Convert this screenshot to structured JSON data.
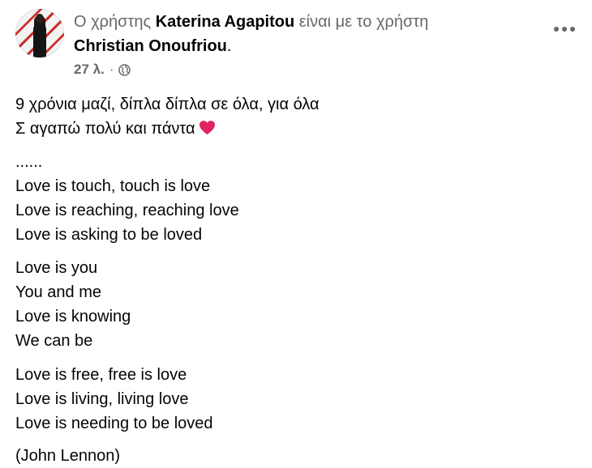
{
  "post": {
    "header": {
      "prefix": "Ο χρήστης ",
      "author": "Katerina Agapitou",
      "middle": " είναι με το χρήστη",
      "tagged": "Christian Onoufriou",
      "suffix": "."
    },
    "meta": {
      "time": "27 λ.",
      "separator": "·",
      "audience_icon": "globe-icon"
    },
    "more_icon": "more-options-icon",
    "paragraphs": [
      {
        "lines": [
          "9 χρόνια μαζί, δίπλα δίπλα σε όλα, για όλα",
          "Σ αγαπώ πολύ και πάντα"
        ]
      },
      {
        "lines": [
          "......",
          "Love is touch, touch is love",
          "Love is reaching, reaching love",
          "Love is asking to be loved"
        ]
      },
      {
        "lines": [
          "Love is you",
          "You and me",
          "Love is knowing",
          "We can be"
        ]
      },
      {
        "lines": [
          "Love is free, free is love",
          "Love is living, living love",
          "Love is needing to be loved"
        ]
      },
      {
        "lines": [
          "(John Lennon)"
        ]
      }
    ],
    "emoji": "heart-icon",
    "colors": {
      "secondary_text": "#65676b",
      "primary_text": "#050505",
      "heart": "#e0245e"
    }
  }
}
